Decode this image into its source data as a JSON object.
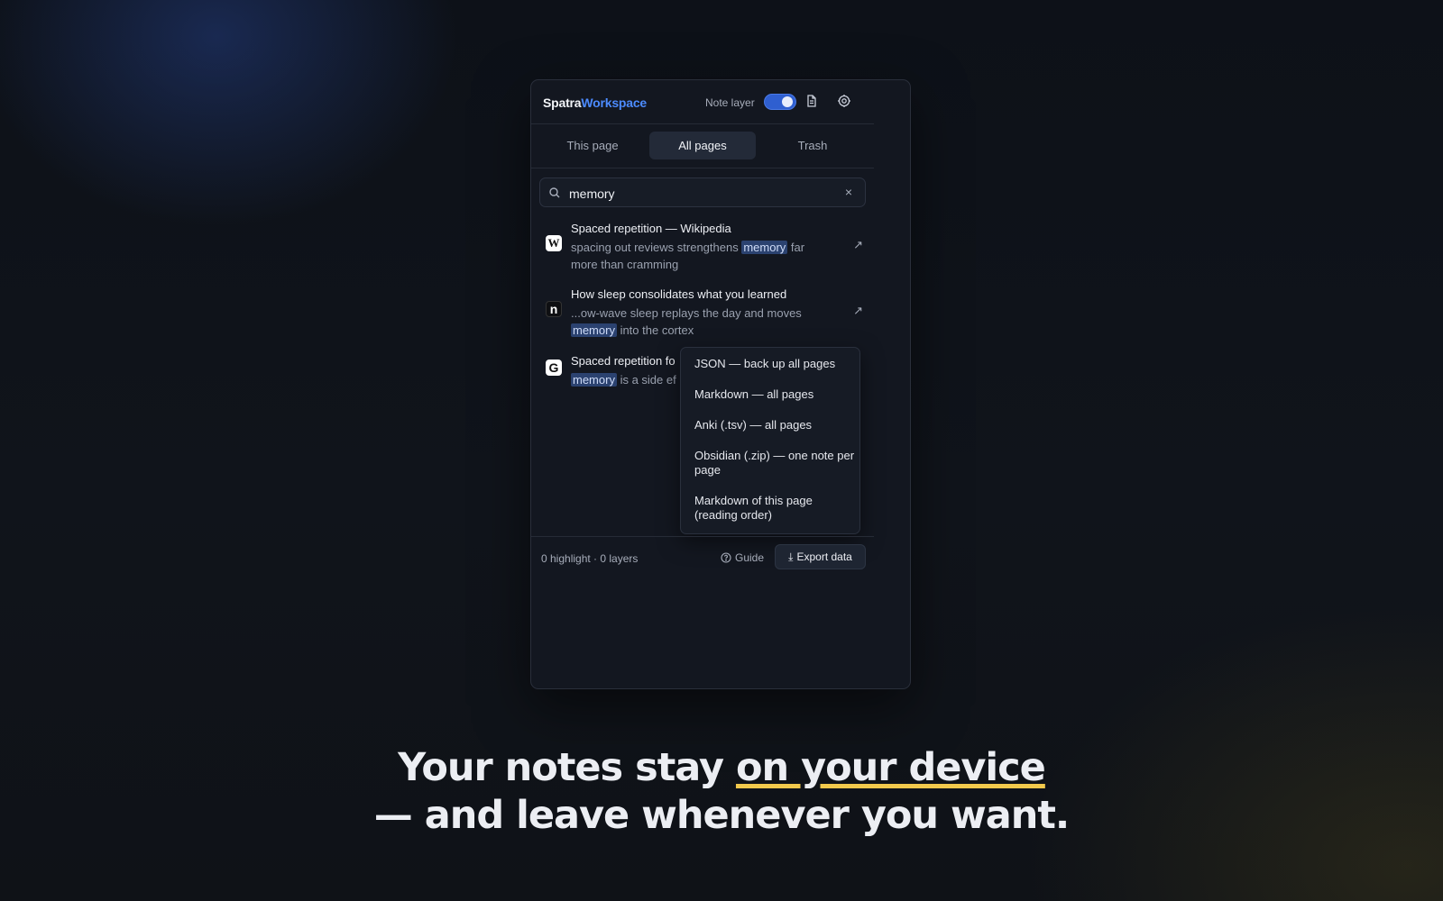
{
  "brand": {
    "name_part1": "Spatra",
    "name_part2": "Workspace"
  },
  "header": {
    "note_layer_label": "Note layer",
    "note_layer_on": true,
    "icons": [
      "document-icon",
      "settings-icon"
    ]
  },
  "tabs": [
    {
      "label": "This page",
      "active": false
    },
    {
      "label": "All pages",
      "active": true
    },
    {
      "label": "Trash",
      "active": false
    }
  ],
  "search": {
    "value": "memory",
    "clear_glyph": "×"
  },
  "results": [
    {
      "favicon": "W",
      "title": "Spaced repetition — Wikipedia",
      "snippet_before": "spacing out reviews strengthens ",
      "snippet_match": "memory",
      "snippet_after": " far more than cramming"
    },
    {
      "favicon": "n",
      "title": "How sleep consolidates what you learned",
      "snippet_before": "...ow-wave sleep replays the day and moves ",
      "snippet_match": "memory",
      "snippet_after": " into the cortex"
    },
    {
      "favicon": "G",
      "title": "Spaced repetition fo",
      "snippet_before": "",
      "snippet_match": "memory",
      "snippet_after": " is a side ef"
    }
  ],
  "export_menu": [
    "JSON — back up all pages",
    "Markdown — all pages",
    "Anki (.tsv) — all pages",
    "Obsidian (.zip) — one note per page",
    "Markdown of this page (reading order)"
  ],
  "footer": {
    "stats": "0 highlight · 0 layers",
    "guide_label": "Guide",
    "export_label": "Export data"
  },
  "headline": {
    "line1_before": "Your notes stay ",
    "line1_underlined": "on your device",
    "line2": "— and leave whenever you want."
  },
  "colors": {
    "accent": "#4c8bff",
    "underline": "#f2c94c",
    "highlight": "#2b4270"
  }
}
